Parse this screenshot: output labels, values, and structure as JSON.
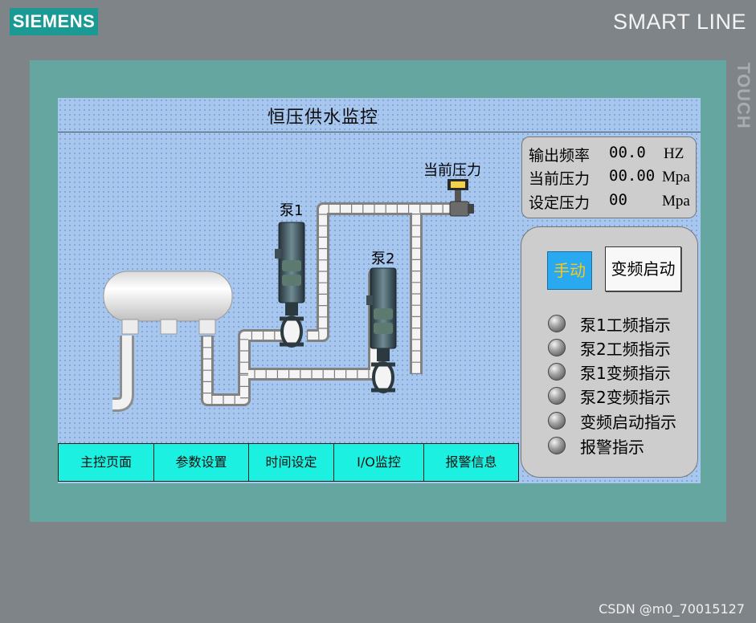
{
  "device": {
    "brand": "SIEMENS",
    "model": "SMART LINE",
    "side_label": "TOUCH"
  },
  "screen": {
    "title": "恒压供水监控",
    "pump1_label": "泵1",
    "pump2_label": "泵2",
    "pressure_sensor_label": "当前压力"
  },
  "info": {
    "rows": [
      {
        "label": "输出频率",
        "value": "00.0",
        "unit": "HZ"
      },
      {
        "label": "当前压力",
        "value": "00.00",
        "unit": "Mpa"
      },
      {
        "label": "设定压力",
        "value": "00",
        "unit": "Mpa"
      }
    ]
  },
  "control": {
    "manual_label": "手动",
    "vfd_start_label": "变频启动",
    "indicators": [
      {
        "label": "泵1工频指示"
      },
      {
        "label": "泵2工频指示"
      },
      {
        "label": "泵1变频指示"
      },
      {
        "label": "泵2变频指示"
      },
      {
        "label": "变频启动指示"
      },
      {
        "label": "报警指示"
      }
    ]
  },
  "nav": {
    "items": [
      "主控页面",
      "参数设置",
      "时间设定",
      "I/O监控",
      "报警信息"
    ]
  },
  "watermark": "CSDN @m0_70015127",
  "colors": {
    "screen_bg": "#a8c7ef",
    "nav_bg": "#1cf0e0",
    "manual_bg": "#29a9ef",
    "manual_text": "#f7c81d",
    "bezel": "#65a6a1"
  }
}
